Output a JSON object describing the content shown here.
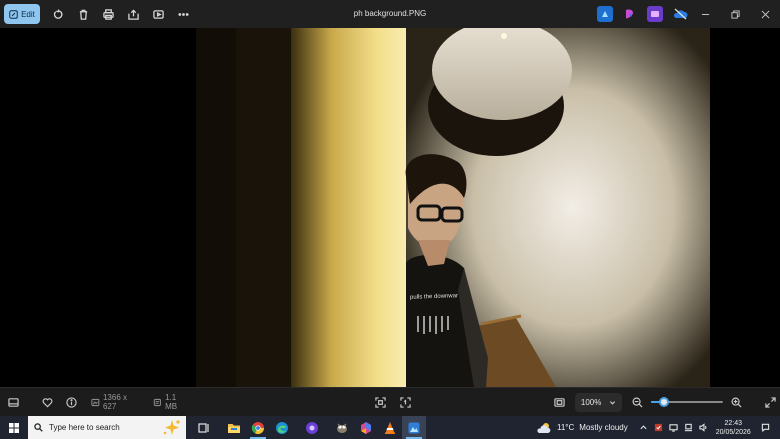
{
  "toolbar": {
    "edit_label": "Edit",
    "file_name": "ph background.PNG",
    "icons": [
      "rotate-icon",
      "delete-icon",
      "print-icon",
      "share-icon",
      "slideshow-icon",
      "more-icon"
    ]
  },
  "photo": {
    "shirt_text": "pulls the downwar"
  },
  "status": {
    "dimensions": "1366 x 627",
    "file_size": "1.1 MB",
    "zoom_value": "100%",
    "zoom_level_fraction": 0.18
  },
  "taskbar": {
    "search_placeholder": "Type here to search",
    "weather_temp": "11°C",
    "weather_desc": "Mostly cloudy",
    "time": "22:43",
    "date": "20/05/2026"
  },
  "colors": {
    "accent": "#4aa3e8",
    "edit_button": "#8fc6f0",
    "titlebar": "#202020",
    "taskbar": "#1f2430"
  }
}
